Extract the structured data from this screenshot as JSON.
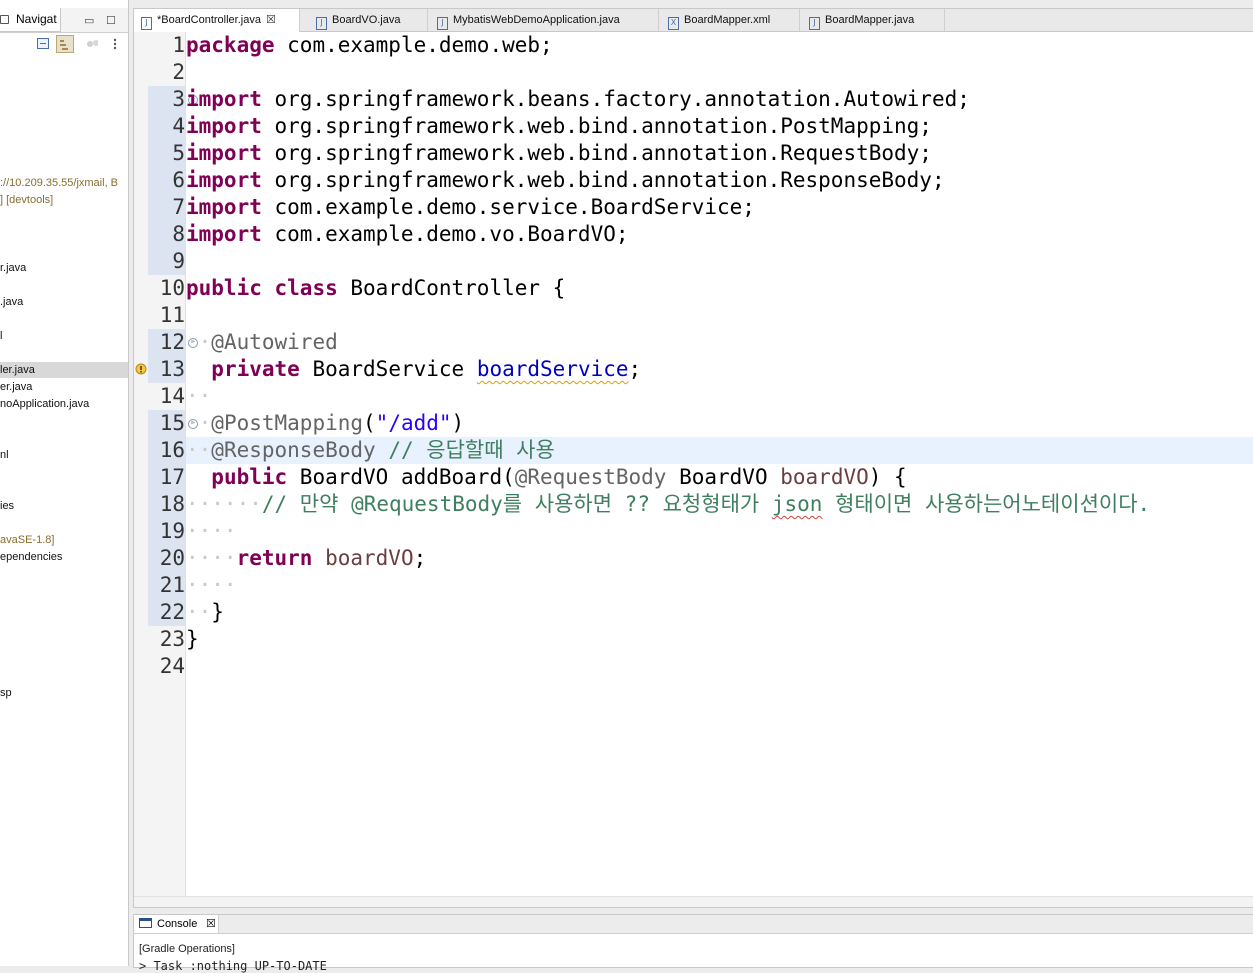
{
  "navigator": {
    "tab_label": "Navigat",
    "minimize_glyph": "▭",
    "maximize_glyph": "☐",
    "tree": [
      {
        "label": "://10.209.35.55/jxmail, B",
        "style": "deco"
      },
      {
        "label": "] [devtools]",
        "style": "deco"
      },
      {
        "label": "r.java",
        "style": ""
      },
      {
        "label": ".java",
        "style": ""
      },
      {
        "label": "l",
        "style": ""
      },
      {
        "label": "ler.java",
        "style": "sel"
      },
      {
        "label": "er.java",
        "style": ""
      },
      {
        "label": "noApplication.java",
        "style": ""
      },
      {
        "label": "nl",
        "style": ""
      },
      {
        "label": "ies",
        "style": ""
      },
      {
        "label": "avaSE-1.8]",
        "style": "deco"
      },
      {
        "label": "ependencies",
        "style": ""
      },
      {
        "label": "sp",
        "style": ""
      }
    ]
  },
  "editor": {
    "tabs": [
      {
        "label": "*BoardController.java",
        "icon": "J",
        "active": true,
        "close": "☒"
      },
      {
        "label": "BoardVO.java",
        "icon": "J",
        "active": false
      },
      {
        "label": "MybatisWebDemoApplication.java",
        "icon": "J",
        "active": false
      },
      {
        "label": "BoardMapper.xml",
        "icon": "X",
        "active": false
      },
      {
        "label": "BoardMapper.java",
        "icon": "J",
        "active": false
      }
    ],
    "line_numbers": [
      "1",
      "2",
      "3",
      "4",
      "5",
      "6",
      "7",
      "8",
      "9",
      "10",
      "11",
      "12",
      "13",
      "14",
      "15",
      "16",
      "17",
      "18",
      "19",
      "20",
      "21",
      "22",
      "23",
      "24"
    ],
    "code": {
      "l1_kw": "package",
      "l1_rest": " com.example.demo.web;",
      "import_kw": "import",
      "l3_rest": " org.springframework.beans.factory.annotation.Autowired;",
      "l4_rest": " org.springframework.web.bind.annotation.PostMapping;",
      "l5_rest": " org.springframework.web.bind.annotation.RequestBody;",
      "l6_rest": " org.springframework.web.bind.annotation.ResponseBody;",
      "l7_rest": " com.example.demo.service.BoardService;",
      "l8_rest": " com.example.demo.vo.BoardVO;",
      "l10_kw1": "public",
      "l10_kw2": "class",
      "l10_rest": " BoardController {",
      "l12_ann": "@Autowired",
      "l13_kw": "private",
      "l13_type": " BoardService ",
      "l13_field": "boardService",
      "l13_end": ";",
      "l15_ann": "@PostMapping",
      "l15_open": "(",
      "l15_str": "\"/add\"",
      "l15_close": ")",
      "l16_ann": "@ResponseBody",
      "l16_cm": " // 응답할때 사용",
      "l17_kw": "public",
      "l17_a": " BoardVO addBoard(",
      "l17_ann": "@RequestBody",
      "l17_b": " BoardVO ",
      "l17_param": "boardVO",
      "l17_c": ") {",
      "l18_cm1": "// 만약 @RequestBody를 사용하면 ?? 요청형태가 ",
      "l18_json": "json",
      "l18_cm2": " 형태이면 사용하는어노테이션이다.",
      "l20_kw": "return",
      "l20_var": " boardVO",
      "l20_end": ";",
      "l22": "}",
      "l23": "}"
    }
  },
  "console": {
    "tab_label": "Console",
    "close": "☒",
    "title": "[Gradle Operations]",
    "output": "> Task :nothing UP-TO-DATE"
  }
}
